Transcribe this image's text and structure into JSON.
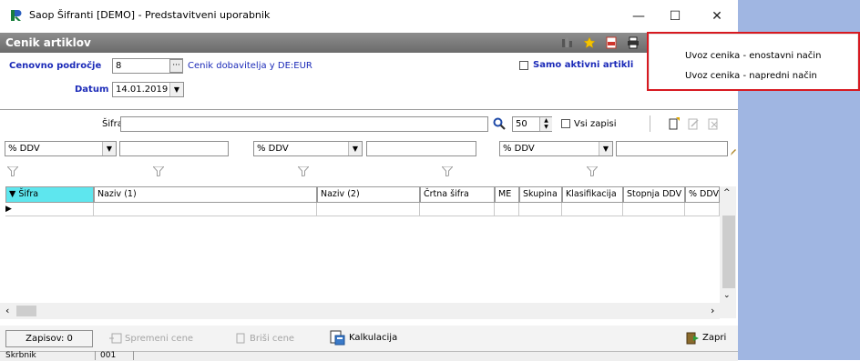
{
  "window": {
    "title": "Saop Šifranti  [DEMO] - Predstavitveni uporabnik",
    "minimize_glyph": "—",
    "maximize_glyph": "☐",
    "close_glyph": "✕"
  },
  "form": {
    "title": "Cenik artiklov"
  },
  "filters": {
    "cenovno_podrocje_label": "Cenovno področje",
    "cenovno_podrocje_value": "8",
    "lookup_button": "···",
    "cenik_text": "Cenik dobavitelja y  DE:EUR",
    "datum_label": "Datum",
    "datum_value": "14.01.2019",
    "samo_aktivni_label": "Samo aktivni artikli"
  },
  "search": {
    "sifra_label": "Šifra",
    "sifra_value": "",
    "count_value": "50",
    "vsi_zapisi_label": "Vsi zapisi"
  },
  "ddv_filters": [
    {
      "select": "% DDV",
      "text": ""
    },
    {
      "select": "% DDV",
      "text": ""
    },
    {
      "select": "% DDV",
      "text": ""
    }
  ],
  "grid": {
    "columns": [
      "▼ Šifra",
      "Naziv (1)",
      "Naziv (2)",
      "Črtna šifra",
      "ME",
      "Skupina",
      "Klasifikacija",
      "Stopnja DDV",
      "% DDV"
    ]
  },
  "bottom": {
    "zapisov_label": "Zapisov: 0",
    "spremeni_cene": "Spremeni cene",
    "brisi_cene": "Briši cene",
    "kalkulacija": "Kalkulacija",
    "zapri": "Zapri"
  },
  "status": {
    "left": "Skrbnik",
    "code": "001"
  },
  "context_menu": {
    "items": [
      "Uvoz cenika - enostavni način",
      "Uvoz cenika - napredni način"
    ]
  },
  "colors": {
    "form_bar": "#7b7b7b",
    "label_blue": "#1b2ab8",
    "grid_header_selected": "#5ee6ee",
    "highlight_red": "#d71920",
    "right_panel": "#a0b6e2"
  }
}
